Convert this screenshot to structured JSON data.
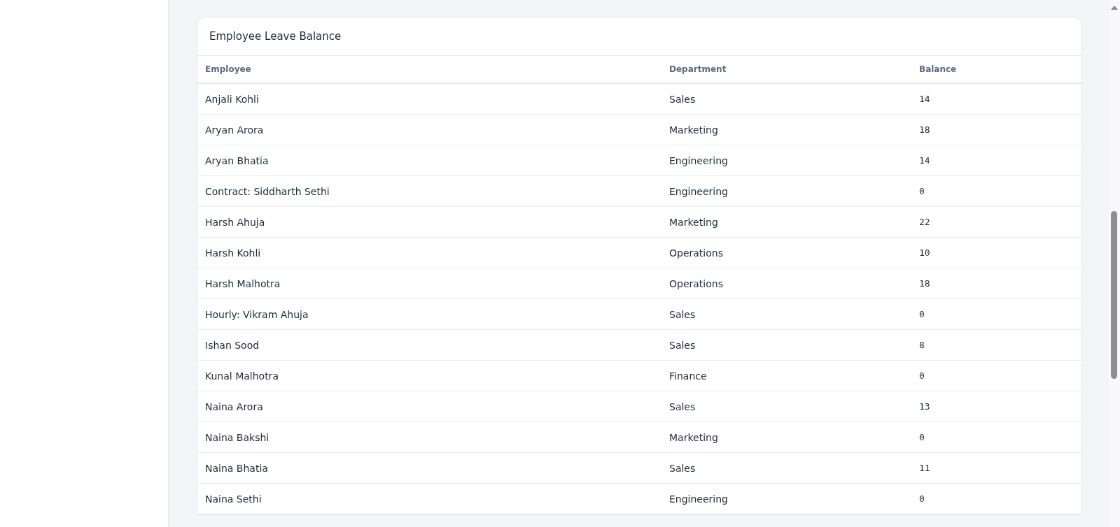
{
  "card": {
    "title": "Employee Leave Balance"
  },
  "table": {
    "columns": [
      "Employee",
      "Department",
      "Balance"
    ],
    "rows": [
      [
        "Anjali Kohli",
        "Sales",
        "14"
      ],
      [
        "Aryan Arora",
        "Marketing",
        "18"
      ],
      [
        "Aryan Bhatia",
        "Engineering",
        "14"
      ],
      [
        "Contract: Siddharth Sethi",
        "Engineering",
        "0"
      ],
      [
        "Harsh Ahuja",
        "Marketing",
        "22"
      ],
      [
        "Harsh Kohli",
        "Operations",
        "10"
      ],
      [
        "Harsh Malhotra",
        "Operations",
        "18"
      ],
      [
        "Hourly: Vikram Ahuja",
        "Sales",
        "0"
      ],
      [
        "Ishan Sood",
        "Sales",
        "8"
      ],
      [
        "Kunal Malhotra",
        "Finance",
        "0"
      ],
      [
        "Naina Arora",
        "Sales",
        "13"
      ],
      [
        "Naina Bakshi",
        "Marketing",
        "0"
      ],
      [
        "Naina Bhatia",
        "Sales",
        "11"
      ],
      [
        "Naina Sethi",
        "Engineering",
        "0"
      ]
    ]
  }
}
